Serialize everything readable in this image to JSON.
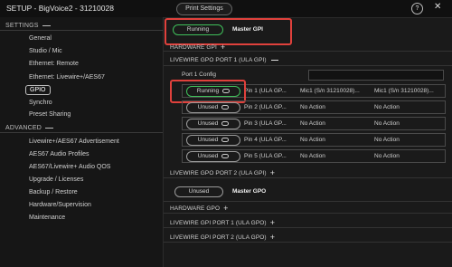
{
  "titlebar": {
    "title": "SETUP - BigVoice2 - 31210028",
    "print_label": "Print Settings",
    "help": "?",
    "close": "✕"
  },
  "sidebar": {
    "settings_label": "SETTINGS",
    "settings_items": [
      "General",
      "Studio / Mic",
      "Ethernet: Remote",
      "Ethernet: Livewire+/AES67",
      "GPIO",
      "Synchro",
      "Preset Sharing"
    ],
    "advanced_label": "ADVANCED",
    "advanced_items": [
      "Livewire+/AES67 Advertisement",
      "AES67 Audio Profiles",
      "AES67/Livewire+ Audio QOS",
      "Upgrade / Licenses",
      "Backup / Restore",
      "Hardware/Supervision",
      "Maintenance"
    ]
  },
  "main": {
    "master_gpi": {
      "status": "Running",
      "label": "Master GPI"
    },
    "hardware_gpi": "HARDWARE GPI",
    "lw_gpo_port1": "LIVEWIRE GPO PORT 1 (ULA GPI)",
    "port1_config": "Port 1 Config",
    "pins": [
      {
        "status": "Running",
        "pin": "Pin 1 (ULA GP...",
        "src1": "Mic1 (S/n 31210028)...",
        "src2": "Mic1 (S/n 31210028)..."
      },
      {
        "status": "Unused",
        "pin": "Pin 2 (ULA GP...",
        "src1": "No Action",
        "src2": "No Action"
      },
      {
        "status": "Unused",
        "pin": "Pin 3 (ULA GP...",
        "src1": "No Action",
        "src2": "No Action"
      },
      {
        "status": "Unused",
        "pin": "Pin 4 (ULA GP...",
        "src1": "No Action",
        "src2": "No Action"
      },
      {
        "status": "Unused",
        "pin": "Pin 5 (ULA GP...",
        "src1": "No Action",
        "src2": "No Action"
      }
    ],
    "lw_gpo_port2": "LIVEWIRE GPO PORT 2 (ULA GPI)",
    "master_gpo": {
      "status": "Unused",
      "label": "Master GPO"
    },
    "hardware_gpo": "HARDWARE GPO",
    "lw_gpi_port1": "LIVEWIRE GPI PORT 1 (ULA GPO)",
    "lw_gpi_port2": "LIVEWIRE GPI PORT 2 (ULA GPO)"
  },
  "colors": {
    "running": "#3fbf5a",
    "highlight": "#e0413c"
  }
}
